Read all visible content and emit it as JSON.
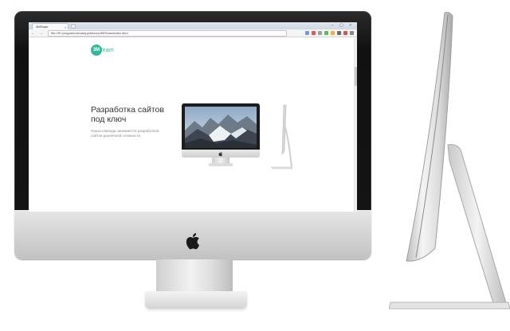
{
  "browser": {
    "tab_title": "3MTeam",
    "tab_close": "×",
    "window_controls": "– ▢ ×",
    "nav_icons": "← → ⟳",
    "url": "file:///E:/programms/xampp/htdocs/3MTeam/index.html"
  },
  "site": {
    "logo_badge": "3M",
    "logo_text": "Team",
    "headline": "Разработка сайтов под ключ",
    "subtext": "Наша команда занимается разработкой сайтов различной сложности."
  },
  "colors": {
    "accent": "#33b89a",
    "bezel": "#141414",
    "aluminum": "#d2d2d2"
  },
  "icons": [
    "apple-logo-icon",
    "back-icon",
    "forward-icon",
    "reload-icon",
    "close-icon"
  ]
}
